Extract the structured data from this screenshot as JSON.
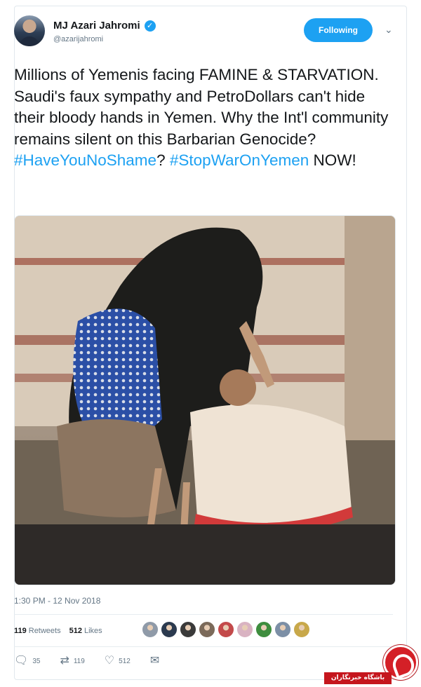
{
  "author": {
    "display_name": "MJ Azari Jahromi",
    "handle": "@azarijahromi",
    "verified_icon": "verified-badge-icon",
    "follow_label": "Following",
    "menu_icon": "chevron-down-icon"
  },
  "tweet": {
    "text_plain": "Millions of Yemenis facing FAMINE & STARVATION. Saudi's faux sympathy and PetroDollars can't hide their bloody hands in Yemen. Why the Int'l community remains silent on this Barbarian Genocide? ",
    "hashtag_1": "#HaveYouNoShame",
    "separator": "? ",
    "hashtag_2": "#StopWarOnYemen",
    "text_tail": " NOW!",
    "timestamp": "1:30 PM - 12 Nov 2018"
  },
  "media": {
    "type": "photo"
  },
  "stats": {
    "retweets_count": "119",
    "retweets_label": "Retweets",
    "likes_count": "512",
    "likes_label": "Likes",
    "likers": [
      "#8f9aa8",
      "#2b3a4f",
      "#3a3a3a",
      "#7b6a5a",
      "#c34a4a",
      "#d9b3c2",
      "#3e8d3e",
      "#7c8fa6",
      "#c8a84a"
    ]
  },
  "actions": {
    "reply_icon": "reply-icon",
    "reply_count": "35",
    "retweet_icon": "retweet-icon",
    "retweet_count": "119",
    "like_icon": "heart-icon",
    "like_count": "512",
    "dm_icon": "envelope-icon"
  },
  "watermark": {
    "text": "باشگاه خبرنگاران"
  },
  "colors": {
    "accent": "#1da1f2",
    "text": "#14171a",
    "muted": "#657786",
    "border": "#e1e8ed"
  }
}
